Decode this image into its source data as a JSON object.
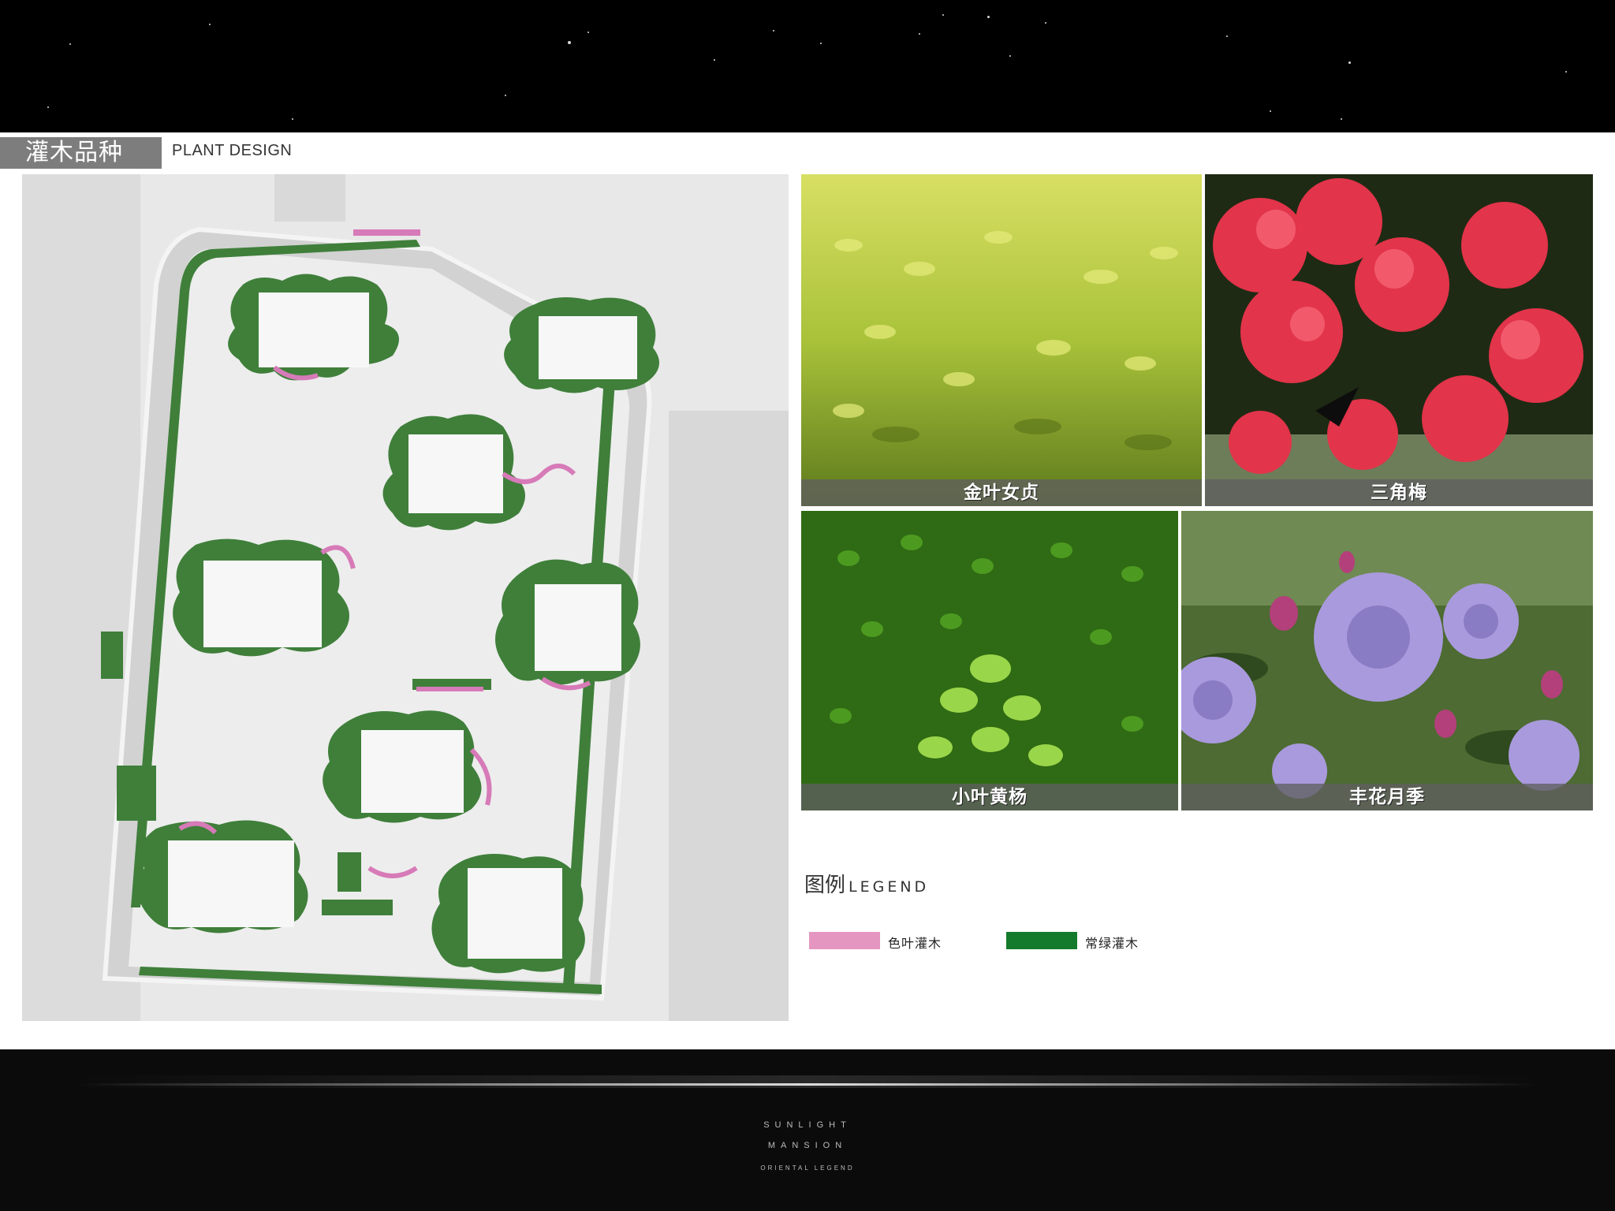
{
  "header": {
    "title_cn": "灌木品种",
    "title_en": "PLANT DESIGN"
  },
  "plan": {
    "icon": "site-plan"
  },
  "photos": [
    {
      "caption": "金叶女贞",
      "icon": "golden-privet-photo"
    },
    {
      "caption": "三角梅",
      "icon": "bougainvillea-photo"
    },
    {
      "caption": "小叶黄杨",
      "icon": "boxwood-photo"
    },
    {
      "caption": "丰花月季",
      "icon": "floribunda-rose-photo"
    }
  ],
  "legend": {
    "title_cn": "图例",
    "title_en": "LEGEND",
    "items": [
      {
        "label": "色叶灌木",
        "color": "#e596c0"
      },
      {
        "label": "常绿灌木",
        "color": "#137b2b"
      }
    ]
  },
  "footer": {
    "line1": "SUNLIGHT",
    "line2": "MANSION",
    "line3": "ORIENTAL LEGEND"
  },
  "colors": {
    "shrub_green": "#3f7f3a",
    "shrub_pink": "#d77ab8",
    "plan_bg": "#e6e6e6"
  }
}
